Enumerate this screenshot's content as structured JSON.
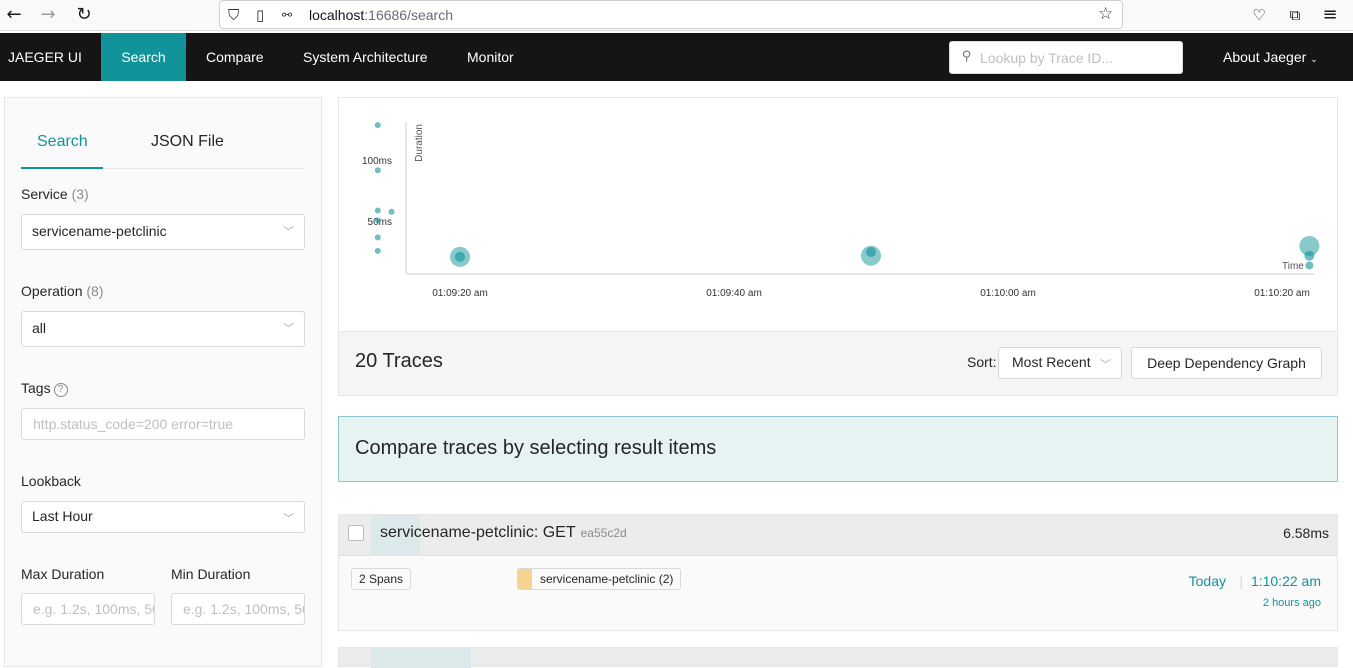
{
  "browser": {
    "url_host": "localhost",
    "url_rest": ":16686/search"
  },
  "nav": {
    "brand": "JAEGER UI",
    "items": [
      "Search",
      "Compare",
      "System Architecture",
      "Monitor"
    ],
    "lookup_placeholder": "Lookup by Trace ID...",
    "about": "About Jaeger"
  },
  "form": {
    "tabs": [
      "Search",
      "JSON File"
    ],
    "service_label": "Service",
    "service_count": "(3)",
    "service_value": "servicename-petclinic",
    "operation_label": "Operation",
    "operation_count": "(8)",
    "operation_value": "all",
    "tags_label": "Tags",
    "tags_placeholder": "http.status_code=200 error=true",
    "lookback_label": "Lookback",
    "lookback_value": "Last Hour",
    "max_duration_label": "Max Duration",
    "min_duration_label": "Min Duration",
    "max_duration_placeholder": "e.g. 1.2s, 100ms, 500us",
    "min_duration_placeholder": "e.g. 1.2s, 100ms, 500us"
  },
  "chart_data": {
    "type": "scatter",
    "xlabel": "Time",
    "ylabel": "Duration",
    "y_ticks": [
      "50ms",
      "100ms"
    ],
    "x_ticks": [
      "01:09:20 am",
      "01:09:40 am",
      "01:10:00 am",
      "01:10:20 am"
    ],
    "color": "#11939a",
    "points": [
      {
        "t": "01:09:14",
        "ms": 122
      },
      {
        "t": "01:09:14",
        "ms": 85
      },
      {
        "t": "01:09:14",
        "ms": 52
      },
      {
        "t": "01:09:14",
        "ms": 44
      },
      {
        "t": "01:09:14",
        "ms": 30
      },
      {
        "t": "01:09:14",
        "ms": 19
      },
      {
        "t": "01:09:15",
        "ms": 51
      },
      {
        "t": "01:09:20",
        "ms": 14
      },
      {
        "t": "01:09:20",
        "ms": 14
      },
      {
        "t": "01:09:50",
        "ms": 15
      },
      {
        "t": "01:09:50",
        "ms": 18
      },
      {
        "t": "01:10:22",
        "ms": 23
      },
      {
        "t": "01:10:22",
        "ms": 15
      },
      {
        "t": "01:10:22",
        "ms": 7
      }
    ]
  },
  "results": {
    "count_text": "20 Traces",
    "sort_label": "Sort:",
    "sort_value": "Most Recent",
    "ddg_button": "Deep Dependency Graph",
    "compare_text": "Compare traces by selecting result items"
  },
  "traces": [
    {
      "title": "servicename-petclinic: GET",
      "id": "ea55c2d",
      "duration": "6.58ms",
      "spans": "2 Spans",
      "service": "servicename-petclinic (2)",
      "date": "Today",
      "time": "1:10:22 am",
      "ago": "2 hours ago"
    }
  ]
}
